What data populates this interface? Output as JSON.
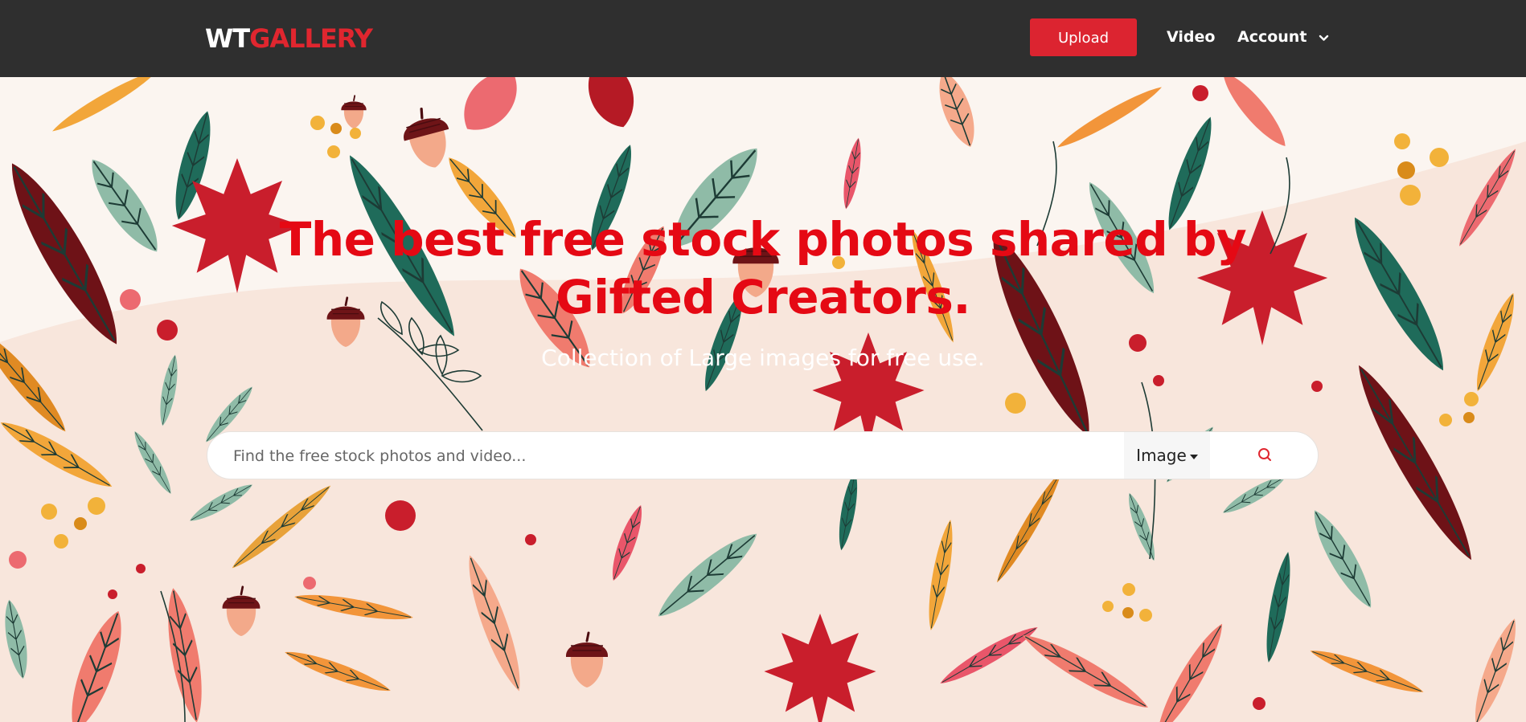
{
  "brand": {
    "logo_part1": "WT",
    "logo_part2": "GALLERY",
    "color_accent": "#e0262f"
  },
  "nav": {
    "upload_label": "Upload",
    "video_label": "Video",
    "account_label": "Account",
    "account_icon": "chevron-down-icon",
    "bg_color": "#2f2f2f"
  },
  "hero": {
    "headline": "The best free stock photos shared by Gifted Creators.",
    "subtitle": "Collection of Large images for free use.",
    "headline_color": "#e50914",
    "background": "autumn leaves and acorns illustration"
  },
  "search": {
    "placeholder": "Find the free stock photos and video...",
    "value": "",
    "type_selected": "Image",
    "search_icon": "search-icon"
  }
}
